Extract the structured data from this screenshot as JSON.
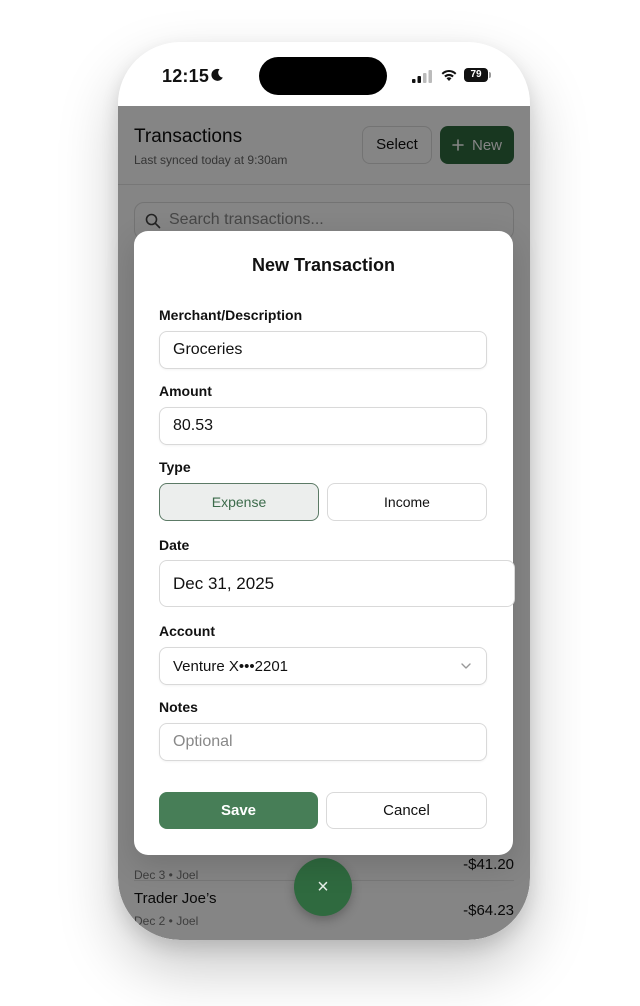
{
  "status_bar": {
    "time": "12:15",
    "battery": "79",
    "icons": [
      "moon-icon",
      "signal-icon",
      "wifi-icon",
      "battery-icon"
    ]
  },
  "header": {
    "title": "Transactions",
    "subtitle": "Last synced today at 9:30am",
    "select_label": "Select",
    "new_label": "New"
  },
  "search": {
    "placeholder": "Search transactions..."
  },
  "transactions": [
    {
      "name": "",
      "meta": "Dec 3 • Joel",
      "amount": "-$41.20"
    },
    {
      "name": "Trader Joe’s",
      "meta": "Dec 2 • Joel",
      "amount": "-$64.23"
    }
  ],
  "fab": {
    "label": "×"
  },
  "modal": {
    "title": "New Transaction",
    "merchant": {
      "label": "Merchant/Description",
      "value": "Groceries"
    },
    "amount": {
      "label": "Amount",
      "value": "80.53"
    },
    "type": {
      "label": "Type",
      "options": [
        "Expense",
        "Income"
      ],
      "selected": "Expense"
    },
    "date": {
      "label": "Date",
      "value": "Dec 31, 2025"
    },
    "account": {
      "label": "Account",
      "value": "Venture X•••2201"
    },
    "notes": {
      "label": "Notes",
      "placeholder": "Optional",
      "value": ""
    },
    "save_label": "Save",
    "cancel_label": "Cancel"
  },
  "colors": {
    "accent": "#2f6a3f",
    "save_button": "#477e57",
    "overlay": "rgba(0,0,0,0.48)"
  }
}
